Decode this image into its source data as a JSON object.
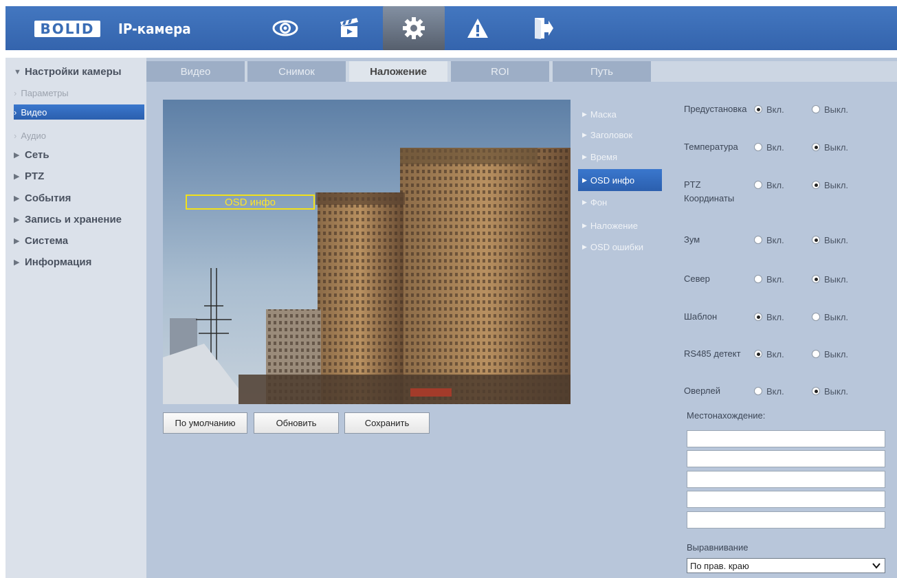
{
  "header": {
    "logo_text": "BOLID",
    "title": "IP-камера",
    "nav_icons": [
      {
        "name": "eye-icon"
      },
      {
        "name": "clapperboard-icon"
      },
      {
        "name": "gear-icon",
        "active": true
      },
      {
        "name": "warning-icon"
      },
      {
        "name": "logout-icon"
      }
    ]
  },
  "sidebar": {
    "camera_settings": "Настройки камеры",
    "params": "Параметры",
    "video": "Видео",
    "audio": "Аудио",
    "network": "Сеть",
    "ptz": "PTZ",
    "events": "События",
    "storage": "Запись и хранение",
    "system": "Система",
    "info": "Информация"
  },
  "tabs": [
    {
      "label": "Видео"
    },
    {
      "label": "Снимок"
    },
    {
      "label": "Наложение",
      "active": true
    },
    {
      "label": "ROI"
    },
    {
      "label": "Путь"
    }
  ],
  "preview": {
    "osd_label": "OSD инфо"
  },
  "buttons": {
    "default": "По умолчанию",
    "refresh": "Обновить",
    "save": "Сохранить"
  },
  "submenu": [
    {
      "label": "Маска"
    },
    {
      "label": "Заголовок"
    },
    {
      "label": "Время"
    },
    {
      "label": "OSD инфо",
      "active": true
    },
    {
      "label": "Фон"
    },
    {
      "label": "Наложение"
    },
    {
      "label": "OSD ошибки"
    }
  ],
  "settings": {
    "on_label": "Вкл.",
    "off_label": "Выкл.",
    "rows": [
      {
        "label": "Предустановка",
        "value": "on"
      },
      {
        "label": "Температура",
        "value": "off"
      },
      {
        "label": "PTZ Координаты",
        "value": "off"
      },
      {
        "label": "Зум",
        "value": "off"
      },
      {
        "label": "Север",
        "value": "off"
      },
      {
        "label": "Шаблон",
        "value": "on"
      },
      {
        "label": "RS485 детект",
        "value": "on"
      },
      {
        "label": "Оверлей",
        "value": "off"
      }
    ],
    "location_label": "Местонахождение:",
    "location_values": [
      "",
      "",
      "",
      "",
      ""
    ],
    "alignment_label": "Выравнивание",
    "alignment_value": "По прав. краю"
  },
  "colors": {
    "header": "#3a6db5",
    "accent": "#2f68bd",
    "panel": "#b8c6da",
    "osd_box": "#f2e11a"
  }
}
